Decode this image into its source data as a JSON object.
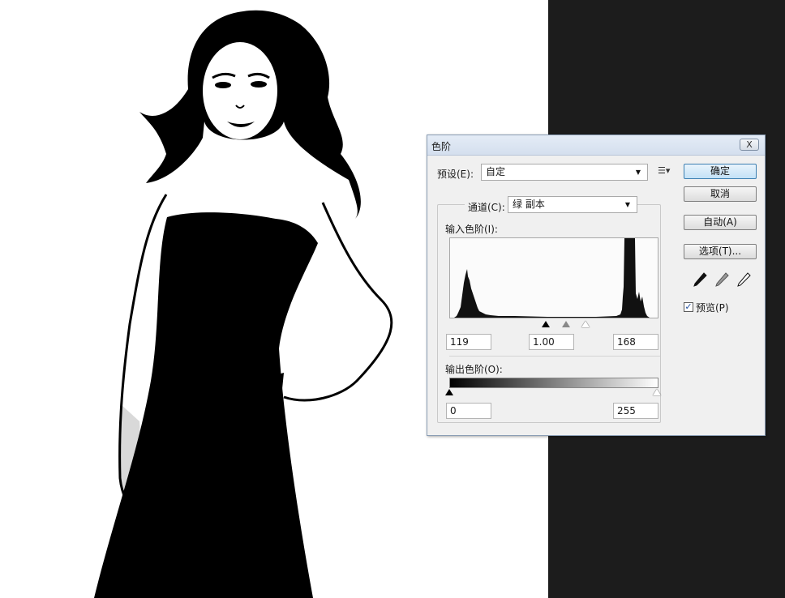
{
  "dialog": {
    "title": "色阶",
    "close_label": "X",
    "preset_label": "预设(E):",
    "preset_value": "自定",
    "preset_menu_icon": "menu-list-icon",
    "channel_label": "通道(C):",
    "channel_value": "绿 副本",
    "input_levels_label": "输入色阶(I):",
    "input_black": "119",
    "input_gamma": "1.00",
    "input_white": "168",
    "output_levels_label": "输出色阶(O):",
    "output_black": "0",
    "output_white": "255",
    "buttons": {
      "ok": "确定",
      "cancel": "取消",
      "auto": "自动(A)",
      "options": "选项(T)..."
    },
    "eyedroppers": [
      "black-eyedropper-icon",
      "gray-eyedropper-icon",
      "white-eyedropper-icon"
    ],
    "preview_label": "预览(P)",
    "preview_checked": true,
    "accent_color": "#3c7fb1"
  },
  "workspace": {
    "canvas_color": "#ffffff",
    "panel_color": "#1c1c1c",
    "image_subject": "black-and-white-woman-photo"
  }
}
